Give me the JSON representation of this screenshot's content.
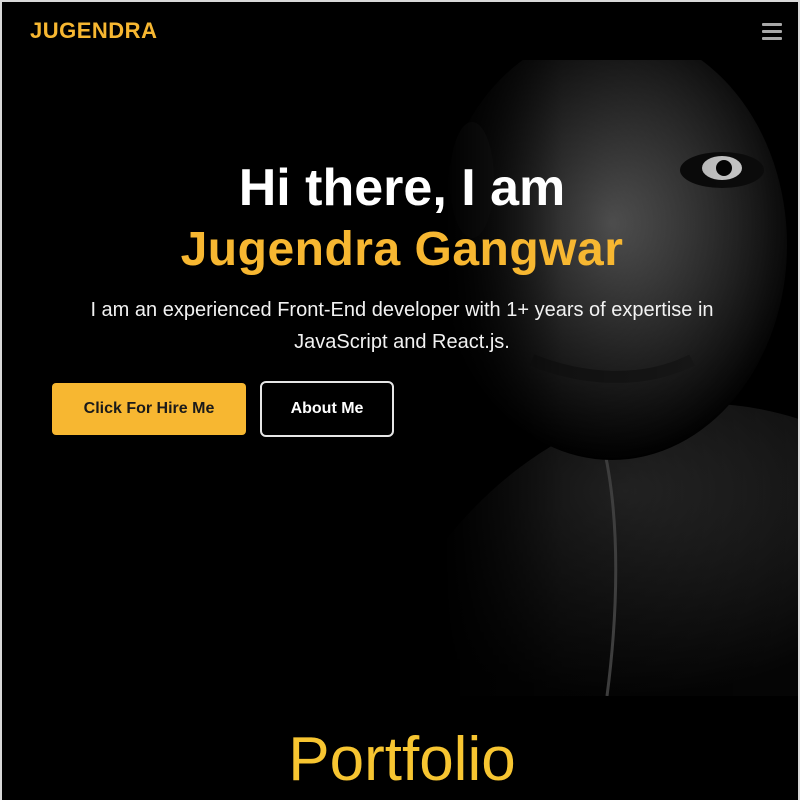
{
  "navbar": {
    "logo": "JUGENDRA",
    "menu_icon": "hamburger-menu-icon"
  },
  "hero": {
    "greeting": "Hi there, I am",
    "name": "Jugendra Gangwar",
    "description": "I am an experienced Front-End developer with 1+ years of expertise in JavaScript and React.js.",
    "primary_button": "Click For Hire Me",
    "secondary_button": "About Me",
    "background_image": "portrait-photo"
  },
  "caption": "Portfolio",
  "colors": {
    "accent": "#f7b731",
    "background": "#000000",
    "text": "#ffffff",
    "caption": "#f7c531"
  }
}
